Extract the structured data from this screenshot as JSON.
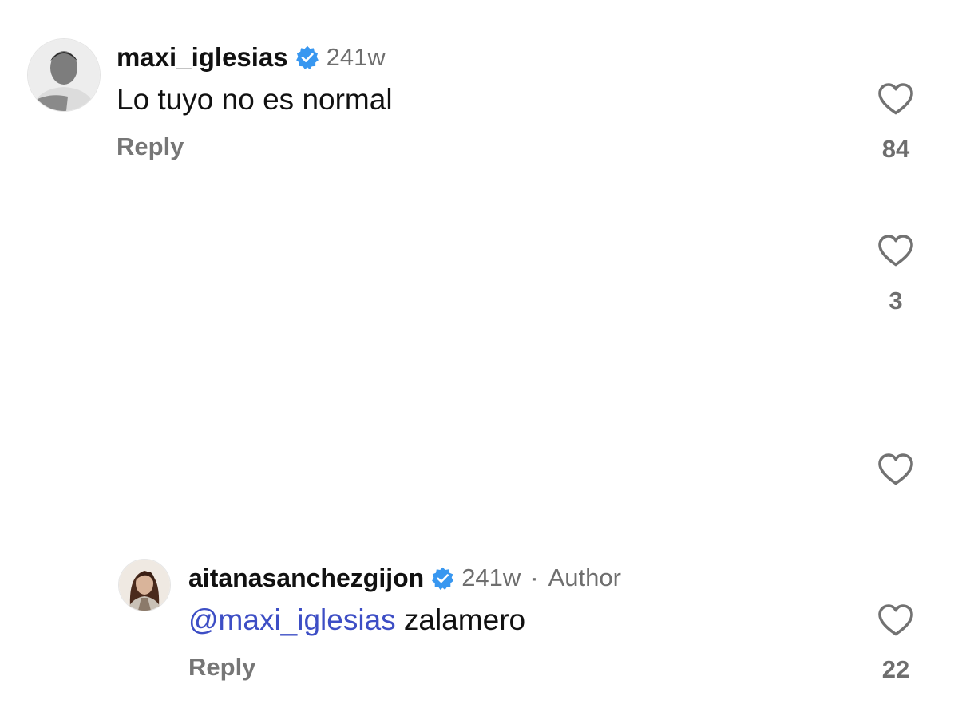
{
  "comments": [
    {
      "username": "maxi_iglesias",
      "time": "241w",
      "text": "Lo tuyo no es normal",
      "reply_label": "Reply",
      "likes": "84"
    },
    {
      "username": "aitanasanchezgijon",
      "time": "241w",
      "separator": "·",
      "author_badge": "Author",
      "mention": "@maxi_iglesias",
      "text": " zalamero",
      "reply_label": "Reply",
      "likes": "22"
    }
  ],
  "hidden_rows": [
    {
      "likes": "3"
    },
    {
      "likes": ""
    }
  ],
  "colors": {
    "verified": "#3897f0",
    "mention": "#3d4ec5",
    "muted": "#6e6e6e"
  },
  "icons": {
    "like": "heart-outline-icon",
    "verified": "verified-badge-icon"
  }
}
